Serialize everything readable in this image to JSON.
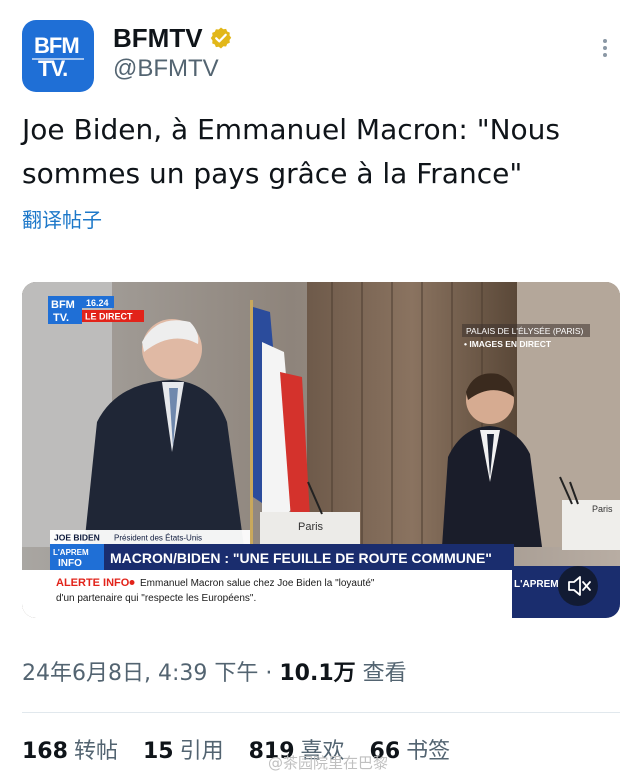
{
  "account": {
    "avatar_line1": "BFM",
    "avatar_line2": "TV.",
    "name": "BFMTV",
    "handle": "@BFMTV"
  },
  "tweet": {
    "text": "Joe Biden, à Emmanuel Macron: \"Nous sommes un pays grâce à la France\"",
    "translate_label": "翻译帖子"
  },
  "video": {
    "logo_line1": "BFM",
    "logo_line2": "TV.",
    "time": "16.24",
    "live_tag": "LE DIRECT",
    "location": "PALAIS DE L'ÉLYSÉE (PARIS)",
    "live_images": "• IMAGES EN DIRECT",
    "speaker_name": "JOE BIDEN",
    "speaker_title": "Président des États-Unis",
    "show_tag_line1": "L'APREM",
    "show_tag_line2": "INFO",
    "headline": "MACRON/BIDEN : \"UNE FEUILLE DE ROUTE COMMUNE\"",
    "alert_label": "ALERTE INFO",
    "alert_text_line1": "Emmanuel Macron salue chez Joe Biden la \"loyauté\"",
    "alert_text_line2": "d'un partenaire qui \"respecte les Européens\".",
    "corner_show": "L'APREM",
    "podium_left": "Paris",
    "podium_right": "Paris"
  },
  "meta": {
    "timestamp": "24年6月8日, 4:39 下午",
    "separator": "·",
    "views_count": "10.1万",
    "views_label": "查看"
  },
  "engagement": {
    "reposts_count": "168",
    "reposts_label": "转帖",
    "quotes_count": "15",
    "quotes_label": "引用",
    "likes_count": "819",
    "likes_label": "喜欢",
    "bookmarks_count": "66",
    "bookmarks_label": "书签"
  },
  "watermark": "@茶园院里在巴黎",
  "colors": {
    "brand_blue": "#1f6fd6",
    "verified_gold": "#e2b719",
    "link_blue": "#1d78c9",
    "live_red": "#e2231a"
  }
}
